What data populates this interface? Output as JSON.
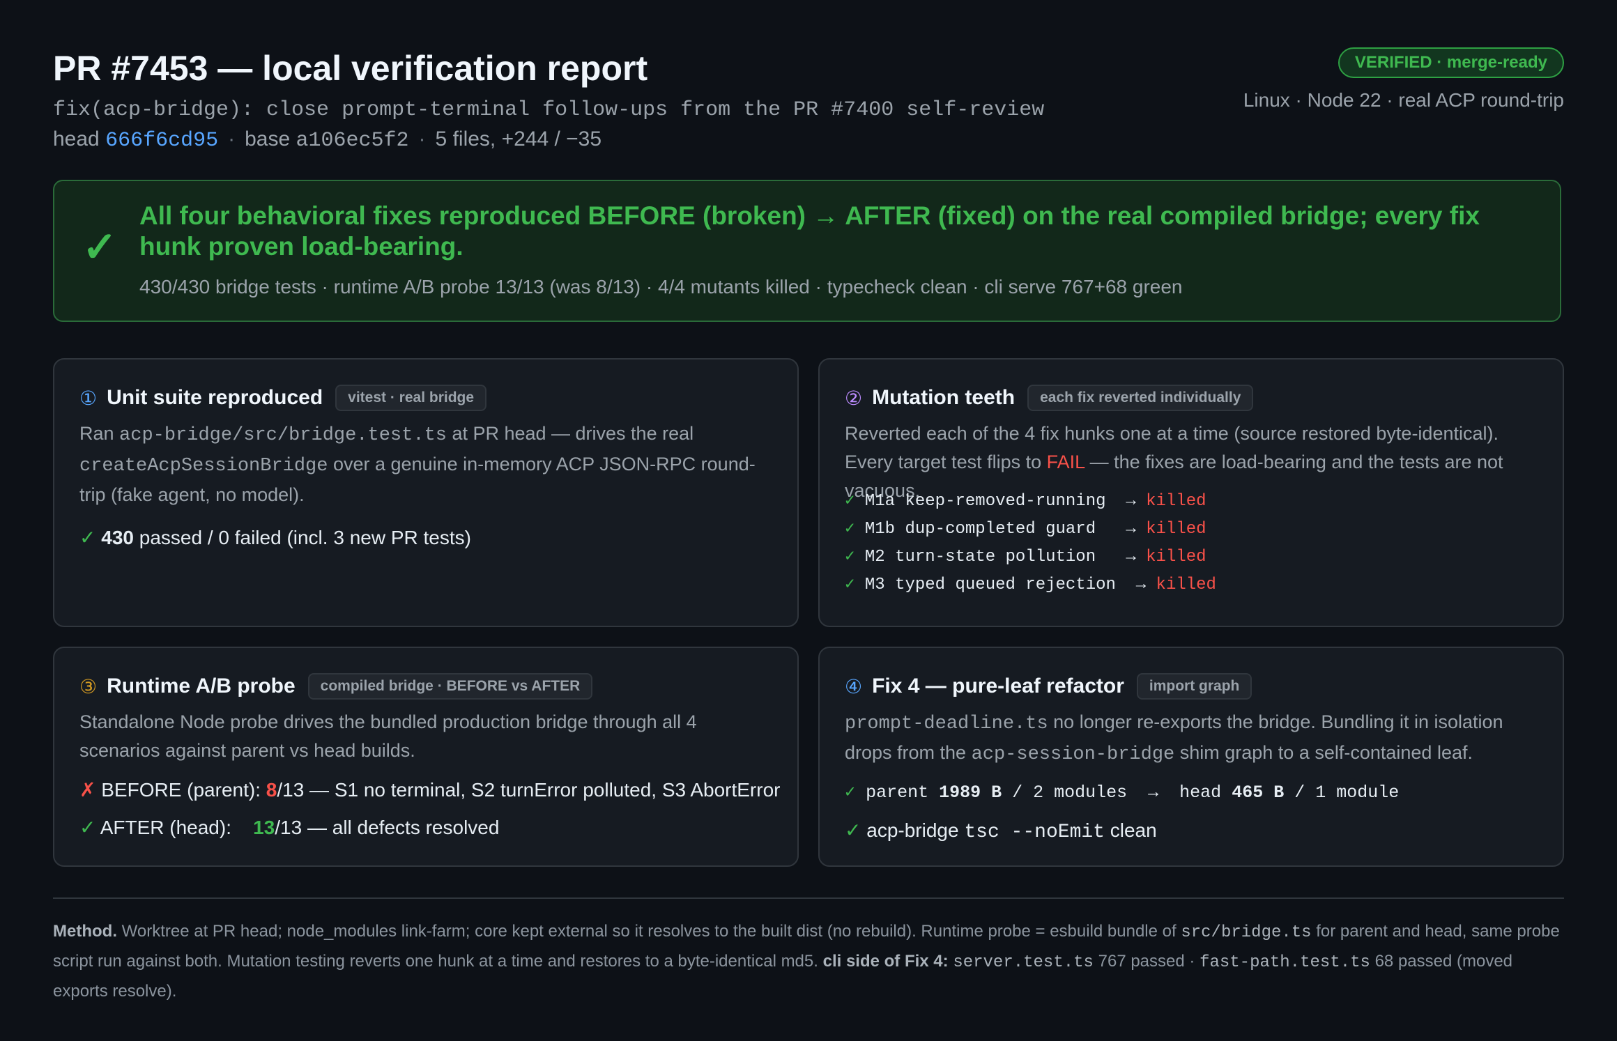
{
  "header": {
    "title": "PR #7453 — local verification report",
    "subtitle": "fix(acp-bridge): close prompt-terminal follow-ups from the PR #7400 self-review",
    "head_label": "head",
    "head_sha": "666f6cd95",
    "base": "base a106ec5f2",
    "diffstat": "5 files, +244 / −35",
    "sep": "·",
    "badge": "VERIFIED · merge-ready",
    "environment": "Linux · Node 22 · real ACP round-trip"
  },
  "banner": {
    "check": "✓",
    "headline": "All four behavioral fixes reproduced BEFORE (broken) → AFTER (fixed) on the real compiled bridge; every fix hunk proven load-bearing.",
    "stats": "430/430 bridge tests · runtime A/B probe 13/13 (was 8/13) · 4/4 mutants killed · typecheck clean · cli serve 767+68 green"
  },
  "cards": [
    {
      "num": "①",
      "title": "Unit suite reproduced",
      "chip": "vitest · real bridge",
      "desc": {
        "t1": "Ran ",
        "c1": "acp-bridge/src/bridge.test.ts",
        "t2": " at PR head — drives the real ",
        "c2": "createAcpSessionBridge",
        "t3": " over a genuine in-memory ACP JSON-RPC round-trip (fake agent, no model)."
      },
      "result": {
        "mark": "✓",
        "count": "430",
        "text": " passed / 0 failed  (incl. 3 new PR tests)"
      }
    },
    {
      "num": "②",
      "title": "Mutation teeth",
      "chip": "each fix reverted individually",
      "desc": {
        "t1": "Reverted each of the 4 fix hunks one at a time (source restored byte-identical). Every target test flips to ",
        "fail": "FAIL",
        "t2": " — the fixes are load-bearing and the tests are not vacuous."
      },
      "mutants": [
        {
          "mark": "✓",
          "name": "M1a keep-removed-running  ",
          "arrow": "→",
          "status": "killed"
        },
        {
          "mark": "✓",
          "name": "M1b dup-completed guard   ",
          "arrow": "→",
          "status": "killed"
        },
        {
          "mark": "✓",
          "name": "M2 turn-state pollution   ",
          "arrow": "→",
          "status": "killed"
        },
        {
          "mark": "✓",
          "name": "M3 typed queued rejection  ",
          "arrow": "→",
          "status": "killed"
        }
      ]
    },
    {
      "num": "③",
      "title": "Runtime A/B probe",
      "chip": "compiled bridge · BEFORE vs AFTER",
      "desc": "Standalone Node probe drives the bundled production bridge through all 4 scenarios against parent vs head builds.",
      "before": {
        "mark": "✗",
        "label": "BEFORE (parent): ",
        "value": "8",
        "rest": "/13 — S1 no terminal, S2 turnError polluted, S3 AbortError"
      },
      "after": {
        "mark": "✓",
        "label": "AFTER (head):    ",
        "value": "13",
        "rest": "/13 — all defects resolved"
      }
    },
    {
      "num": "④",
      "title": "Fix 4 — pure-leaf refactor",
      "chip": "import graph",
      "desc": {
        "c1": "prompt-deadline.ts",
        "t1": " no longer re-exports the bridge. Bundling it in isolation drops from the ",
        "c2": "acp-session-bridge",
        "t2": " shim graph to a self-contained leaf."
      },
      "sizes": {
        "mark": "✓",
        "t1": "parent ",
        "b1": "1989 B",
        "t2": " / 2 modules  →  head ",
        "b2": "465 B",
        "t3": " / 1 module"
      },
      "tsc": {
        "mark": "✓",
        "t1": "acp-bridge ",
        "code": "tsc --noEmit",
        "t2": " clean"
      }
    }
  ],
  "method": {
    "label": "Method.",
    "t1": " Worktree at PR head; node_modules link-farm; core kept external so it resolves to the built dist (no rebuild). Runtime probe = esbuild bundle of ",
    "c1": "src/bridge.ts",
    "t2": " for parent and head, same probe script run against both. Mutation testing reverts one hunk at a time and restores to a byte-identical md5.  ",
    "label2": "cli side of Fix 4:",
    "t3": " ",
    "c2": "server.test.ts",
    "t4": " 767 passed · ",
    "c3": "fast-path.test.ts",
    "t5": " 68 passed (moved exports resolve)."
  },
  "colors": {
    "accent_green": "#3fb950",
    "fail_red": "#f85149",
    "link_blue": "#58a6ff",
    "background": "#0d1117"
  }
}
